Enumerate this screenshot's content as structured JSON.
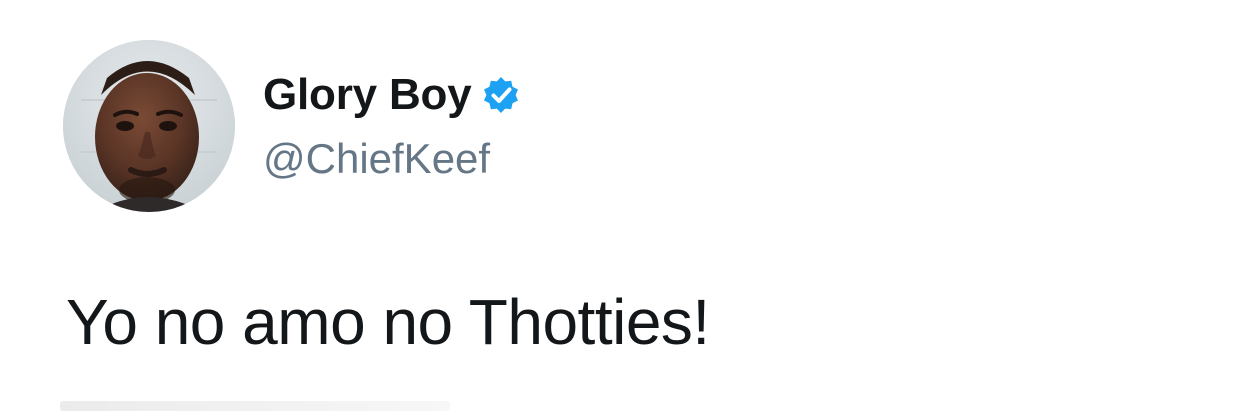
{
  "tweet": {
    "display_name": "Glory Boy",
    "handle": "@ChiefKeef",
    "text": "Yo no amo no Thotties!",
    "verified": true
  },
  "icons": {
    "avatar": "profile-photo",
    "verified": "verified-check-icon"
  },
  "colors": {
    "text_primary": "#14171a",
    "text_secondary": "#657786",
    "verified_blue": "#1da1f2",
    "background": "#ffffff"
  }
}
